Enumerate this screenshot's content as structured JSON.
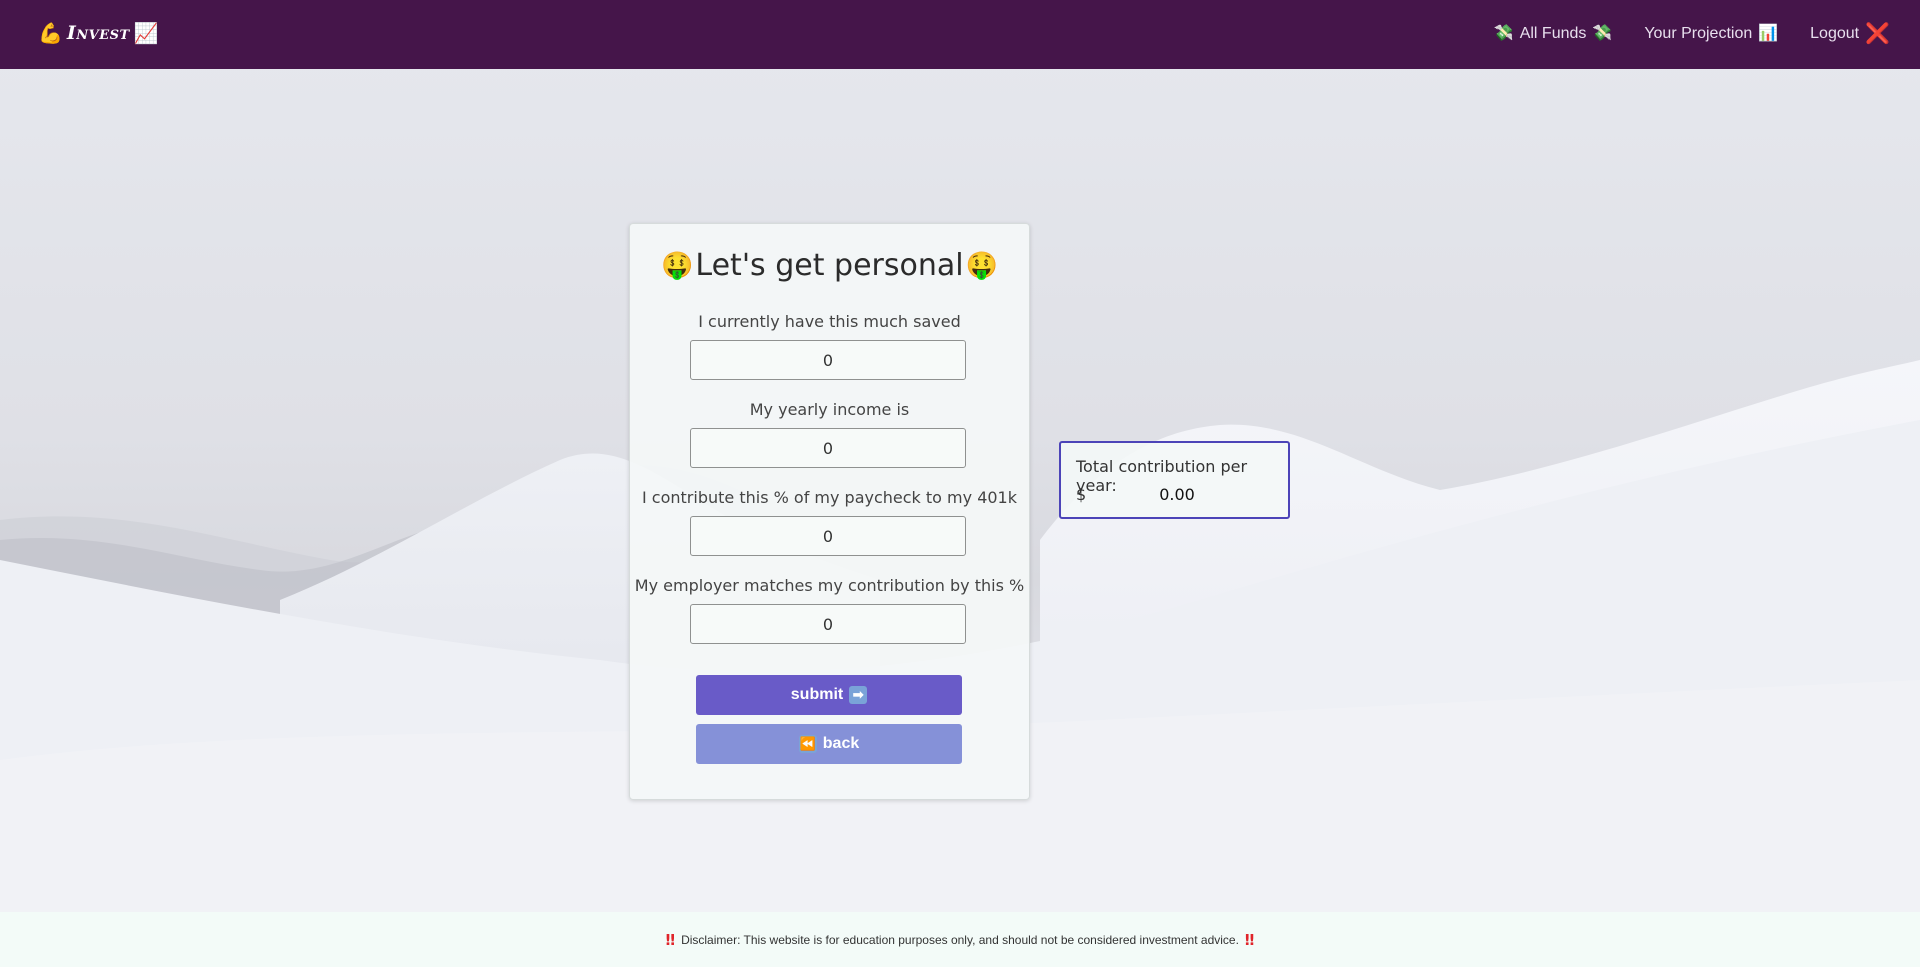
{
  "nav": {
    "brand_icon": "💪",
    "brand_text": "Invest",
    "brand_icon_2": "📈",
    "links": [
      {
        "icon_left": "💸",
        "label": "All Funds",
        "icon_right": "💸"
      },
      {
        "label": "Your Projection",
        "icon_right": "📊"
      },
      {
        "label": "Logout",
        "icon_right": "❌"
      }
    ]
  },
  "form": {
    "title": "Let's get personal",
    "title_emoji": "🤑",
    "fields": [
      {
        "label": "I currently have this much saved",
        "value": "0"
      },
      {
        "label": "My yearly income is",
        "value": "0"
      },
      {
        "label": "I contribute this % of my paycheck to my 401k",
        "value": "0"
      },
      {
        "label": "My employer matches my contribution by this %",
        "value": "0"
      }
    ],
    "submit_label": "submit",
    "submit_icon": "➡",
    "back_label": "back",
    "back_icon": "⏪"
  },
  "total": {
    "label": "Total contribution per year:",
    "currency": "$",
    "value": "0.00"
  },
  "footer": {
    "bang": "‼",
    "text": "Disclaimer: This website is for education purposes only, and should not be considered investment advice."
  },
  "colors": {
    "navbar": "#45154a",
    "submit": "#695bc8",
    "back": "#8591d8",
    "total_border": "#4c44b8",
    "footer_bg": "#f3fbf8"
  }
}
